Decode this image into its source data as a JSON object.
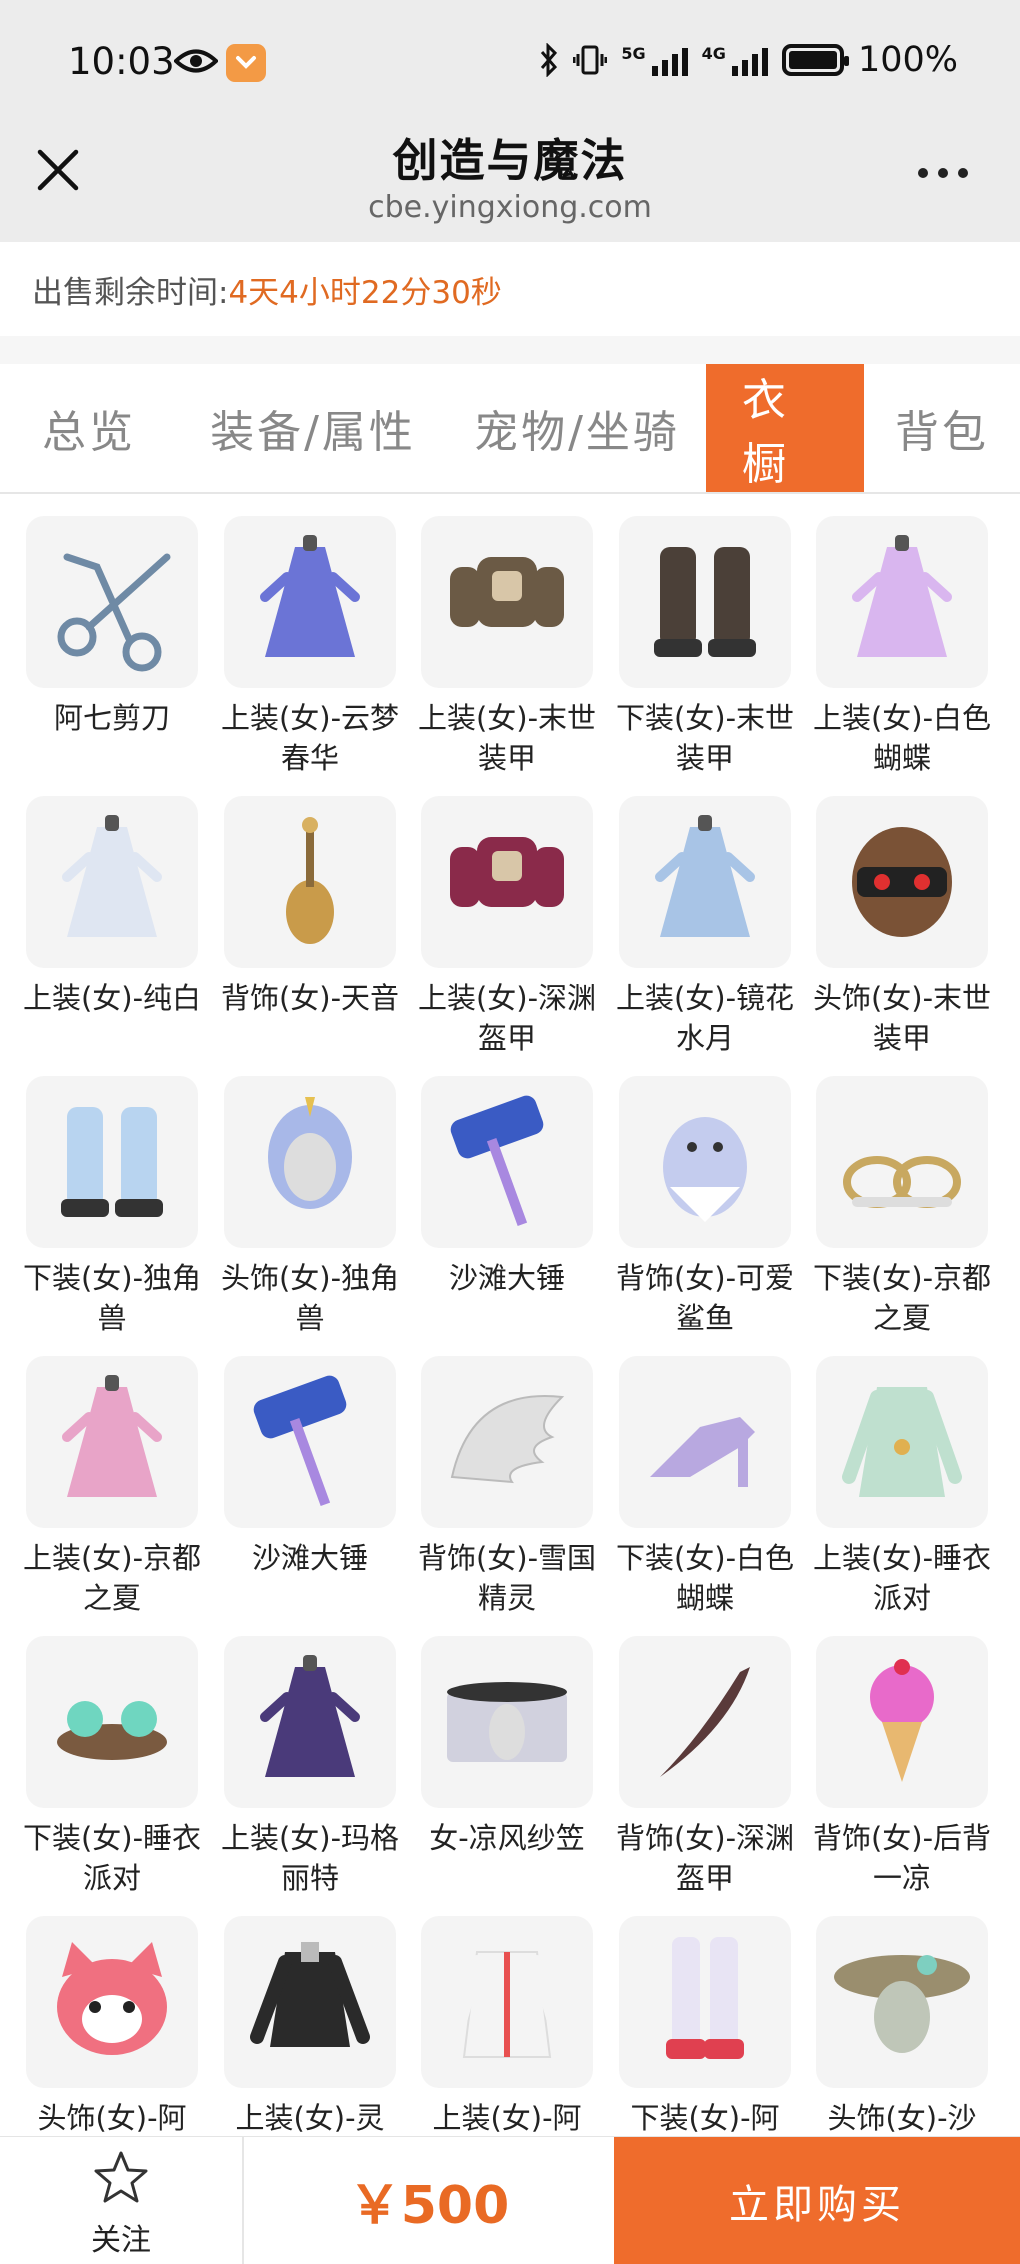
{
  "status_bar": {
    "time": "10:03",
    "net1": "5G",
    "net2": "4G",
    "battery": "100%"
  },
  "header": {
    "title": "创造与魔法",
    "url": "cbe.yingxiong.com"
  },
  "countdown": {
    "label": "出售剩余时间:",
    "value": "4天4小时22分30秒"
  },
  "tabs": [
    {
      "label": "总览",
      "active": false
    },
    {
      "label": "装备/属性",
      "active": false
    },
    {
      "label": "宠物/坐骑",
      "active": false
    },
    {
      "label": "衣橱",
      "active": true
    },
    {
      "label": "背包",
      "active": false
    }
  ],
  "items": [
    {
      "label": "阿七剪刀",
      "icon": "scissors-icon",
      "color": "#6f8aa5"
    },
    {
      "label": "上装(女)-云梦春华",
      "icon": "dress-icon",
      "color": "#6b74d6"
    },
    {
      "label": "上装(女)-末世装甲",
      "icon": "armor-icon",
      "color": "#6b5a45"
    },
    {
      "label": "下装(女)-末世装甲",
      "icon": "boots-icon",
      "color": "#4b4038"
    },
    {
      "label": "上装(女)-白色蝴蝶",
      "icon": "dress-icon",
      "color": "#d9b6ef"
    },
    {
      "label": "上装(女)-纯白",
      "icon": "dress-icon",
      "color": "#dfe6f2"
    },
    {
      "label": "背饰(女)-天音",
      "icon": "lute-icon",
      "color": "#c99b4a"
    },
    {
      "label": "上装(女)-深渊盔甲",
      "icon": "armor-icon",
      "color": "#8a2a4a"
    },
    {
      "label": "上装(女)-镜花水月",
      "icon": "dress-icon",
      "color": "#a8c4e6"
    },
    {
      "label": "头饰(女)-末世装甲",
      "icon": "helmet-icon",
      "color": "#7a5236"
    },
    {
      "label": "下装(女)-独角兽",
      "icon": "boots-icon",
      "color": "#b8d4f0"
    },
    {
      "label": "头饰(女)-独角兽",
      "icon": "head-icon",
      "color": "#a8b8e8"
    },
    {
      "label": "沙滩大锤",
      "icon": "hammer-icon",
      "color": "#3a5bc4"
    },
    {
      "label": "背饰(女)-可爱鲨鱼",
      "icon": "shark-icon",
      "color": "#c4ccee"
    },
    {
      "label": "下装(女)-京都之夏",
      "icon": "sandals-icon",
      "color": "#c8a860"
    },
    {
      "label": "上装(女)-京都之夏",
      "icon": "dress-icon",
      "color": "#e8a4c8"
    },
    {
      "label": "沙滩大锤",
      "icon": "hammer-icon",
      "color": "#3a5bc4"
    },
    {
      "label": "背饰(女)-雪国精灵",
      "icon": "wing-icon",
      "color": "#e0e0e0"
    },
    {
      "label": "下装(女)-白色蝴蝶",
      "icon": "heel-icon",
      "color": "#b8a8e0"
    },
    {
      "label": "上装(女)-睡衣派对",
      "icon": "coat-icon",
      "color": "#bfe0cf"
    },
    {
      "label": "下装(女)-睡衣派对",
      "icon": "slippers-icon",
      "color": "#6fd6c0"
    },
    {
      "label": "上装(女)-玛格丽特",
      "icon": "dress-icon",
      "color": "#4a3a7a"
    },
    {
      "label": "女-凉风纱笠",
      "icon": "hat-icon",
      "color": "#c8c8d8"
    },
    {
      "label": "背饰(女)-深渊盔甲",
      "icon": "blade-icon",
      "color": "#5a3a3a"
    },
    {
      "label": "背饰(女)-后背一凉",
      "icon": "icecream-icon",
      "color": "#e86aca"
    },
    {
      "label": "头饰(女)-阿",
      "icon": "fox-icon",
      "color": "#f07080"
    },
    {
      "label": "上装(女)-灵",
      "icon": "jacket-icon",
      "color": "#2a2a2a"
    },
    {
      "label": "上装(女)-阿",
      "icon": "hoodie-icon",
      "color": "#e85050"
    },
    {
      "label": "下装(女)-阿",
      "icon": "stockings-icon",
      "color": "#e8e4f4"
    },
    {
      "label": "头饰(女)-沙",
      "icon": "sunhat-icon",
      "color": "#9a8e6e"
    }
  ],
  "bottom_bar": {
    "follow_label": "关注",
    "price": "￥500",
    "buy_label": "立即购买"
  }
}
